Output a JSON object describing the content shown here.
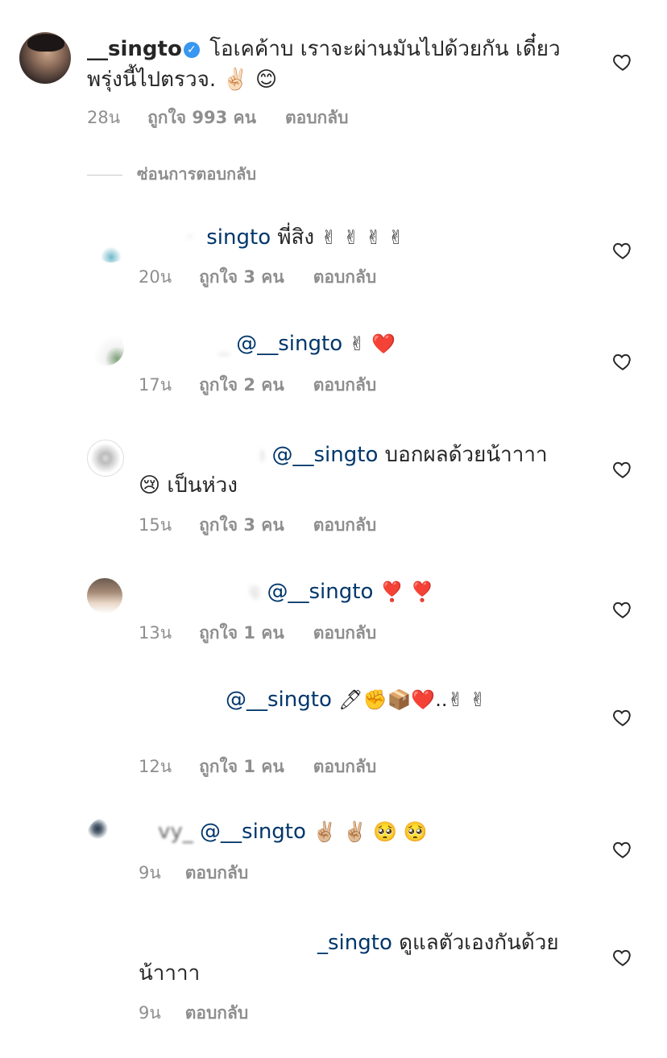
{
  "main_comment": {
    "username": "__singto",
    "verified_mark": "✓",
    "text_line1": " โอเคค้าบ เราจะผ่านมันไปด้วยกัน เดี๋ยว",
    "text_line2": "พรุ่งนี้ไปตรวจ. ✌🏻 😊",
    "time": "28น",
    "likes": "ถูกใจ 993 คน",
    "reply": "ตอบกลับ"
  },
  "hide_replies_label": "ซ่อนการตอบกลับ",
  "replies": [
    {
      "name_fragment": "·",
      "mention": "singto",
      "text": " พี่สิง",
      "text_line2": "",
      "emoji": "✌ ✌ ✌ ✌",
      "time": "20น",
      "likes": "ถูกใจ 3 คน",
      "reply": "ตอบกลับ"
    },
    {
      "name_fragment": "_",
      "mention": " @__singto",
      "text": "",
      "text_line2": "",
      "emoji": "✌ ❤️",
      "time": "17น",
      "likes": "ถูกใจ 2 คน",
      "reply": "ตอบกลับ"
    },
    {
      "name_fragment": "ı",
      "mention": " @__singto",
      "text": " บอกผลด้วยน้าาาา",
      "text_line2": "😢 เป็นห่วง",
      "emoji": "",
      "time": "15น",
      "likes": "ถูกใจ 3 คน",
      "reply": "ตอบกลับ"
    },
    {
      "name_fragment": "จ",
      "mention": " @__singto",
      "text": "",
      "text_line2": "",
      "emoji": "❣️ ❣️",
      "time": "13น",
      "likes": "ถูกใจ 1 คน",
      "reply": "ตอบกลับ"
    },
    {
      "name_fragment": "",
      "mention": " @__singto",
      "text": "",
      "text_line2": "",
      "emoji": "🖊✊📦❤️..✌ ✌",
      "time": "12น",
      "likes": "ถูกใจ 1 คน",
      "reply": "ตอบกลับ"
    },
    {
      "name_fragment": "vy_",
      "mention": " @__singto",
      "text": "",
      "text_line2": "",
      "emoji": "✌🏼 ✌🏼 🥺 🥺",
      "time": "9น",
      "likes": "",
      "reply": "ตอบกลับ"
    },
    {
      "name_fragment": "",
      "mention": "_singto",
      "text": " ดูแลตัวเองกันด้วย",
      "text_line2": "น้าาาา",
      "emoji": "",
      "time": "9น",
      "likes": "",
      "reply": "ตอบกลับ"
    }
  ],
  "icons": {
    "heart": "heart-outline-icon",
    "verified": "verified-badge-icon"
  },
  "colors": {
    "text": "#262626",
    "secondary": "#8e8e8e",
    "mention": "#00376b",
    "verified": "#3897f0"
  }
}
